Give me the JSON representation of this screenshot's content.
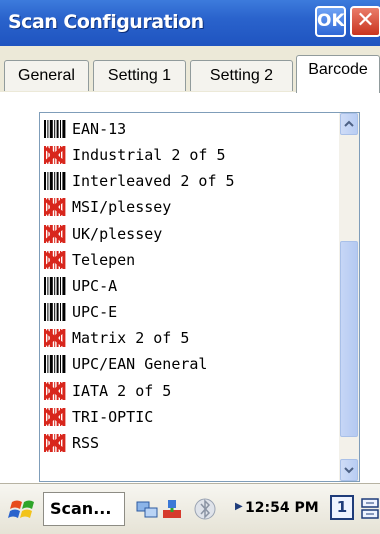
{
  "window": {
    "title": "Scan Configuration",
    "ok_label": "OK",
    "close_glyph": "✕"
  },
  "tabs": [
    {
      "label": "General",
      "active": false
    },
    {
      "label": "Setting 1",
      "active": false
    },
    {
      "label": "Setting 2",
      "active": false
    },
    {
      "label": "Barcode",
      "active": true
    }
  ],
  "barcode_list": {
    "items": [
      {
        "label": "EAN-13",
        "icon": "barcode-enabled-icon"
      },
      {
        "label": "Industrial 2 of 5",
        "icon": "barcode-disabled-icon"
      },
      {
        "label": "Interleaved 2 of 5",
        "icon": "barcode-enabled-icon"
      },
      {
        "label": "MSI/plessey",
        "icon": "barcode-disabled-icon"
      },
      {
        "label": "UK/plessey",
        "icon": "barcode-disabled-icon"
      },
      {
        "label": "Telepen",
        "icon": "barcode-disabled-icon"
      },
      {
        "label": "UPC-A",
        "icon": "barcode-enabled-icon"
      },
      {
        "label": "UPC-E",
        "icon": "barcode-enabled-icon"
      },
      {
        "label": "Matrix 2 of 5",
        "icon": "barcode-disabled-icon"
      },
      {
        "label": "UPC/EAN General",
        "icon": "barcode-enabled-icon"
      },
      {
        "label": "IATA 2 of 5",
        "icon": "barcode-disabled-icon"
      },
      {
        "label": "TRI-OPTIC",
        "icon": "barcode-disabled-icon"
      },
      {
        "label": "RSS",
        "icon": "barcode-disabled-icon"
      }
    ]
  },
  "taskbar": {
    "app_button_label": "Scan...",
    "clock": "12:54 PM",
    "input_badge": "1"
  },
  "colors": {
    "titlebar": "#2a63cc",
    "disabled_icon": "#d8261c",
    "scroll_thumb": "#b8cdf3"
  }
}
